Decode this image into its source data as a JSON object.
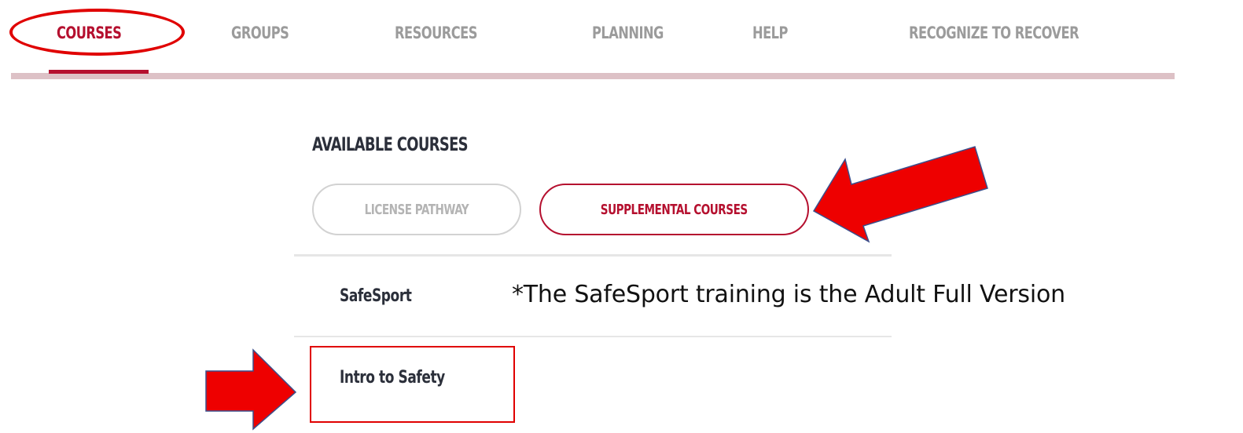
{
  "nav": {
    "items": [
      {
        "label": "COURSES",
        "active": true
      },
      {
        "label": "GROUPS",
        "active": false
      },
      {
        "label": "RESOURCES",
        "active": false
      },
      {
        "label": "PLANNING",
        "active": false
      },
      {
        "label": "HELP",
        "active": false
      },
      {
        "label": "RECOGNIZE TO RECOVER",
        "active": false
      }
    ]
  },
  "section": {
    "title": "AVAILABLE COURSES",
    "filters": [
      {
        "label": "LICENSE PATHWAY",
        "active": false
      },
      {
        "label": "SUPPLEMENTAL COURSES",
        "active": true
      }
    ]
  },
  "courses": [
    {
      "label": "SafeSport"
    },
    {
      "label": "Intro to Safety"
    }
  ],
  "annotation": {
    "note": "*The SafeSport training is the Adult Full Version",
    "highlight_color": "#e00000",
    "arrow_color": "#ee0000",
    "arrow_outline": "#3b4f8c"
  },
  "colors": {
    "accent": "#b5102f",
    "inactive_text": "#9b9b9b",
    "heading_text": "#2b2f3a"
  }
}
